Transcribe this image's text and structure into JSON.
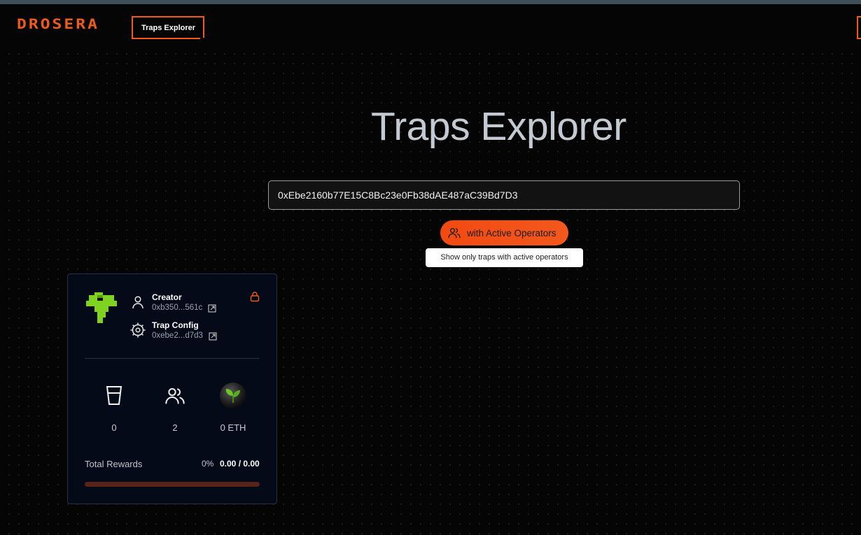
{
  "header": {
    "logo_text": "DROSERA",
    "nav_tab_label": "Traps Explorer",
    "accent_color": "#f25a1a"
  },
  "main": {
    "title": "Traps Explorer",
    "search": {
      "value": "0xEbe2160b77E15C8Bc23e0Fb38dAE487aC39Bd7D3",
      "placeholder": ""
    },
    "filter_button": {
      "label": "with Active Operators",
      "icon": "users-icon"
    },
    "tooltip": "Show only traps with active operators"
  },
  "trap_card": {
    "avatar_icon": "trap-pixel-avatar",
    "creator": {
      "label": "Creator",
      "value": "0xb350...561c",
      "icon": "user-icon"
    },
    "trap_config": {
      "label": "Trap Config",
      "value": "0xebe2...d7d3",
      "icon": "gear-icon"
    },
    "lock_icon": "lock-icon",
    "stats": [
      {
        "icon": "cup-icon",
        "value": "0"
      },
      {
        "icon": "users-icon",
        "value": "2"
      },
      {
        "icon": "sprout-icon",
        "value": "0 ETH"
      }
    ],
    "rewards": {
      "label": "Total Rewards",
      "percent": "0%",
      "amount": "0.00 / 0.00",
      "progress_fraction": 0
    }
  }
}
